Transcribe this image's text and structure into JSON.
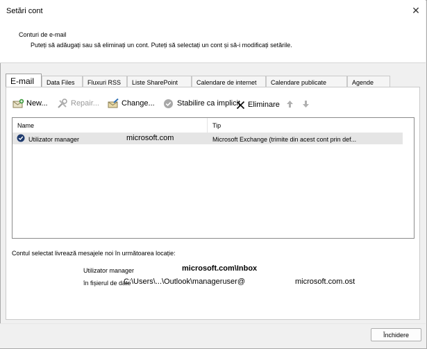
{
  "window": {
    "title": "Setări cont",
    "close_glyph": "✕"
  },
  "banner": {
    "title": "Conturi de e-mail",
    "description": "Puteți să adăugați sau să eliminați un cont. Puteți să selectați un cont și să-i modificați setările."
  },
  "tabs": [
    "E-mail",
    "Data Files",
    "Fluxuri RSS",
    "Liste SharePoint",
    "Calendare de internet",
    "Calendare publicate",
    "Agende"
  ],
  "toolbar": {
    "new_label": "New...",
    "repair_label": "Repair...",
    "change_label": "Change...",
    "set_default_label": "Stabilire ca implicit",
    "remove_label": "Eliminare",
    "icons": [
      "new-account-icon",
      "repair-icon",
      "change-icon",
      "set-default-icon",
      "remove-icon",
      "move-up-icon",
      "move-down-icon"
    ]
  },
  "list": {
    "columns": [
      "Name",
      "Tip"
    ],
    "rows": [
      {
        "name": "Utilizator manager",
        "domain": "microsoft.com",
        "type": "Microsoft Exchange (trimite din acest cont prin def..."
      }
    ]
  },
  "delivery": {
    "intro": "Contul selectat livrează mesajele noi în următoarea locație:",
    "account": "Utilizator manager",
    "mailbox": "microsoft.com\\Inbox",
    "file_label": "în fișierul de date",
    "file_path": "C:\\Users\\...\\Outlook\\manageruser@",
    "file_domain": "microsoft.com.ost"
  },
  "footer": {
    "close_label": "Închidere"
  },
  "colors": {
    "selected_row": "#e5e5e5",
    "disabled_text": "#9a9a9a",
    "default_check": "#1f3b6e"
  }
}
